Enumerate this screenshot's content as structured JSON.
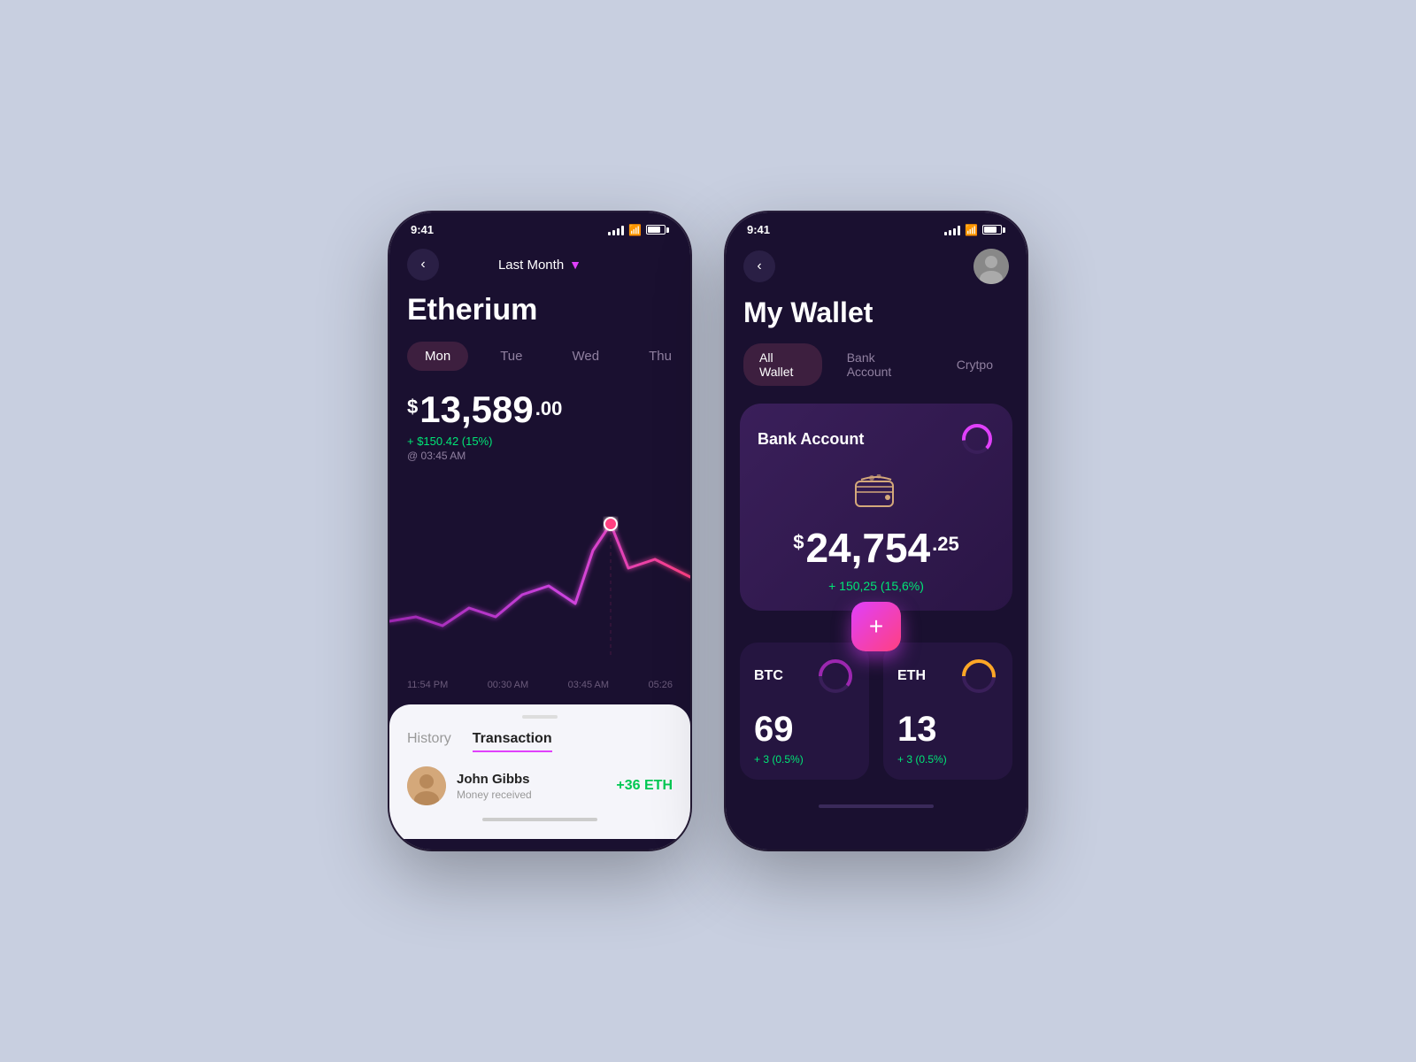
{
  "phone1": {
    "status": {
      "time": "9:41"
    },
    "nav": {
      "period": "Last Month"
    },
    "title": "Etherium",
    "days": [
      "Mon",
      "Tue",
      "Wed",
      "Thu"
    ],
    "active_day": "Mon",
    "price": {
      "dollar_sign": "$",
      "main": "13,589",
      "cents": ".00",
      "change": "+ $150.42 (15%)",
      "time": "@ 03:45 AM"
    },
    "time_labels": [
      "11:54 PM",
      "00:30 AM",
      "03:45 AM",
      "05:26"
    ],
    "sheet": {
      "tabs": [
        "History",
        "Transaction"
      ],
      "active_tab": "Transaction",
      "transaction": {
        "name": "John Gibbs",
        "desc": "Money received",
        "amount": "+36 ETH"
      }
    }
  },
  "phone2": {
    "status": {
      "time": "9:41"
    },
    "title": "My Wallet",
    "tabs": [
      "All Wallet",
      "Bank Account",
      "Crytpo"
    ],
    "active_tab": "All Wallet",
    "bank_card": {
      "title": "Bank Account",
      "dollar_sign": "$",
      "amount": "24,754",
      "cents": ".25",
      "change": "+ 150,25 (15,6%)"
    },
    "add_btn": "+",
    "crypto": [
      {
        "label": "BTC",
        "value": "69",
        "change": "+ 3 (0.5%)"
      },
      {
        "label": "ETH",
        "value": "13",
        "change": "+ 3 (0.5%)"
      }
    ]
  }
}
